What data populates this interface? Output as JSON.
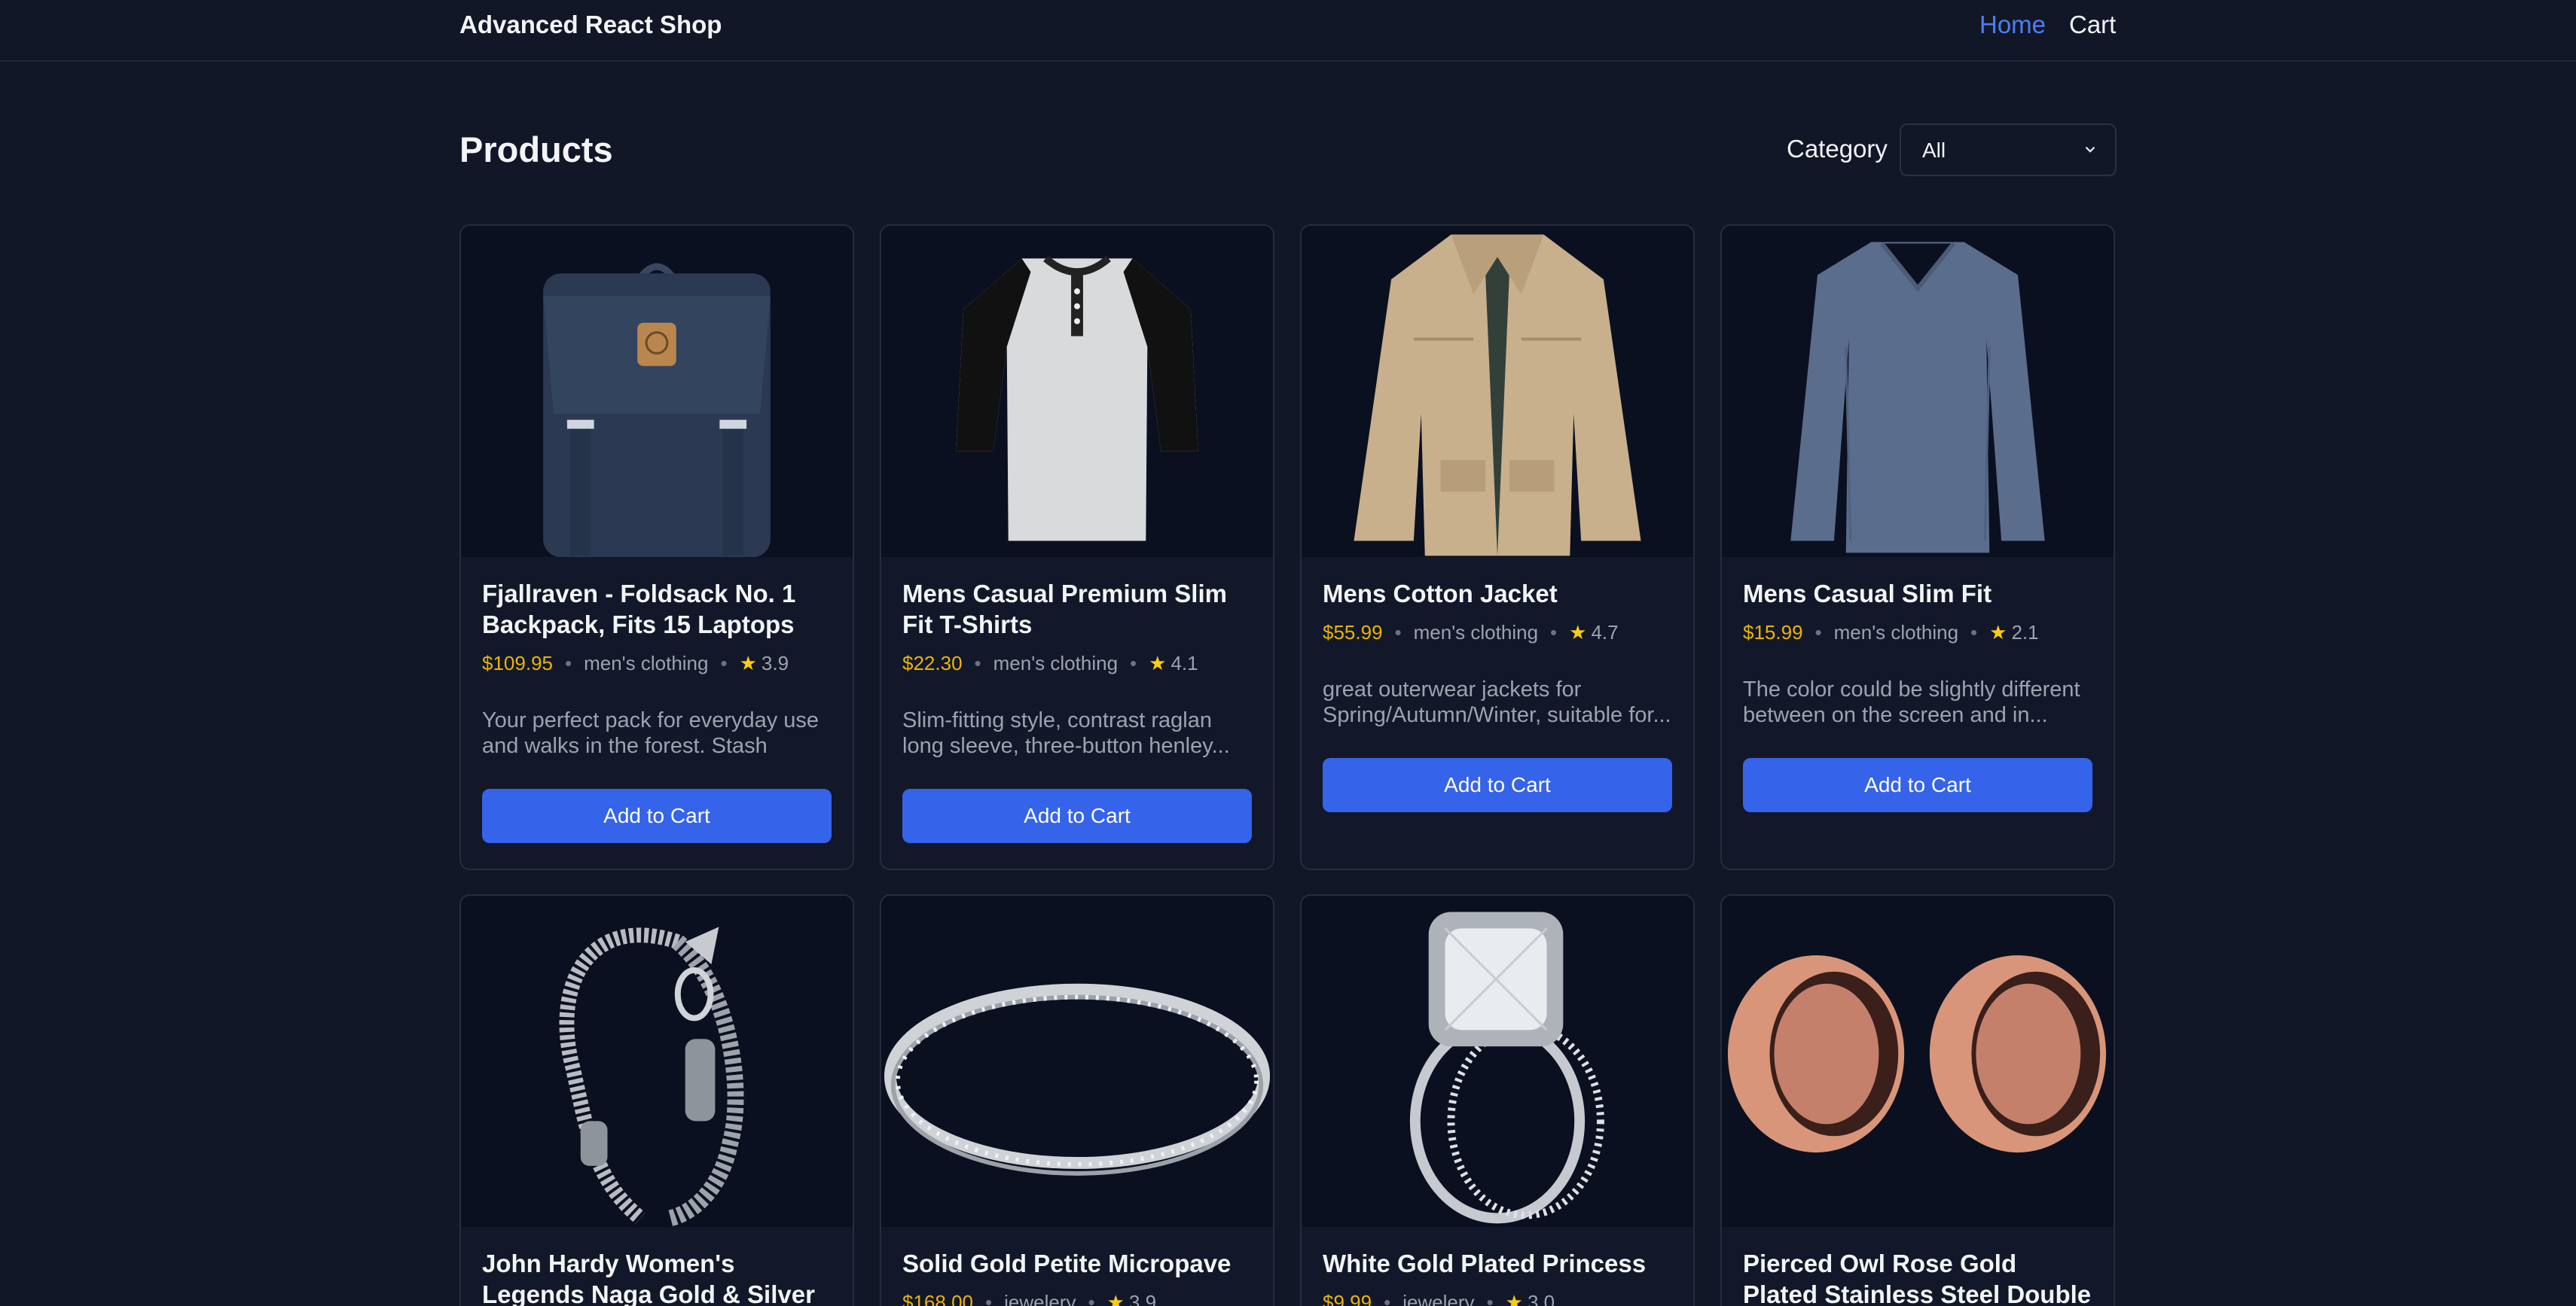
{
  "app": {
    "brand": "Advanced React Shop"
  },
  "nav": {
    "home": "Home",
    "cart": "Cart"
  },
  "page": {
    "title": "Products"
  },
  "filter": {
    "label": "Category",
    "selected": "All"
  },
  "button_label": "Add to Cart",
  "products": [
    {
      "title": "Fjallraven - Foldsack No. 1 Backpack, Fits 15 Laptops",
      "price": "$109.95",
      "category": "men's clothing",
      "rating": "3.9",
      "description": "Your perfect pack for everyday use and walks in the forest. Stash your...",
      "image": "backpack-image"
    },
    {
      "title": "Mens Casual Premium Slim Fit T-Shirts",
      "price": "$22.30",
      "category": "men's clothing",
      "rating": "4.1",
      "description": "Slim-fitting style, contrast raglan long sleeve, three-button henley...",
      "image": "raglan-shirt-image"
    },
    {
      "title": "Mens Cotton Jacket",
      "price": "$55.99",
      "category": "men's clothing",
      "rating": "4.7",
      "description": "great outerwear jackets for Spring/Autumn/Winter, suitable for...",
      "image": "jacket-image"
    },
    {
      "title": "Mens Casual Slim Fit",
      "price": "$15.99",
      "category": "men's clothing",
      "rating": "2.1",
      "description": "The color could be slightly different between on the screen and in...",
      "image": "long-sleeve-shirt-image"
    },
    {
      "title": "John Hardy Women's Legends Naga Gold & Silver",
      "price": "",
      "category": "",
      "rating": "",
      "description": "",
      "image": "bracelet-image"
    },
    {
      "title": "Solid Gold Petite Micropave",
      "price": "$168.00",
      "category": "jewelery",
      "rating": "3.9",
      "description": "",
      "image": "ring-band-image"
    },
    {
      "title": "White Gold Plated Princess",
      "price": "$9.99",
      "category": "jewelery",
      "rating": "3.0",
      "description": "",
      "image": "princess-ring-image"
    },
    {
      "title": "Pierced Owl Rose Gold Plated Stainless Steel Double",
      "price": "",
      "category": "",
      "rating": "",
      "description": "",
      "image": "rose-gold-plugs-image"
    }
  ]
}
